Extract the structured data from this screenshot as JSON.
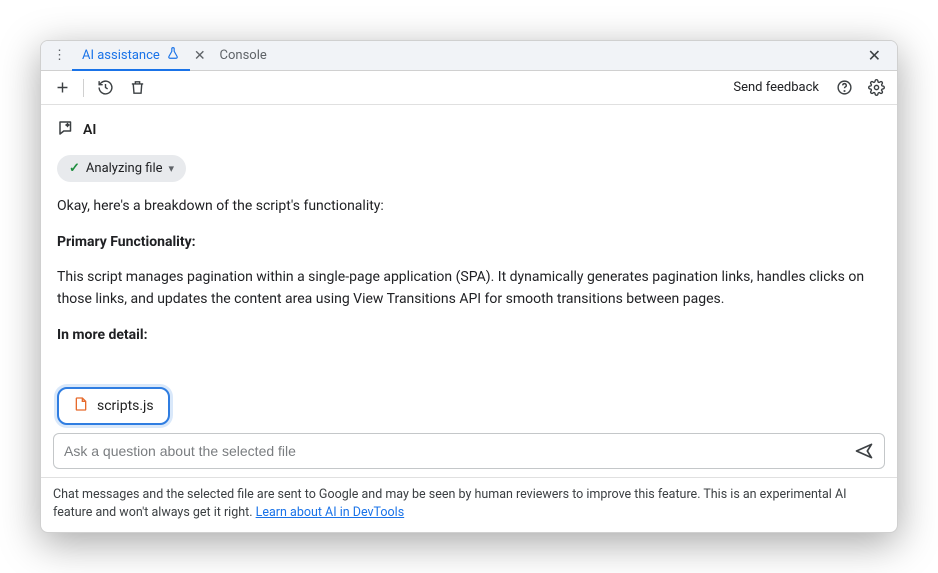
{
  "tabs": {
    "ai_label": "AI assistance",
    "console_label": "Console"
  },
  "toolbar": {
    "feedback": "Send feedback"
  },
  "ai": {
    "heading": "AI",
    "status": "Analyzing file"
  },
  "messages": {
    "intro": "Okay, here's a breakdown of the script's functionality:",
    "h1": "Primary Functionality:",
    "body1": "This script manages pagination within a single-page application (SPA). It dynamically generates pagination links, handles clicks on those links, and updates the content area using View Transitions API for smooth transitions between pages.",
    "h2": "In more detail:"
  },
  "context": {
    "filename": "scripts.js"
  },
  "input": {
    "placeholder": "Ask a question about the selected file"
  },
  "footer": {
    "text": "Chat messages and the selected file are sent to Google and may be seen by human reviewers to improve this feature. This is an experimental AI feature and won't always get it right. ",
    "link": "Learn about AI in DevTools"
  }
}
